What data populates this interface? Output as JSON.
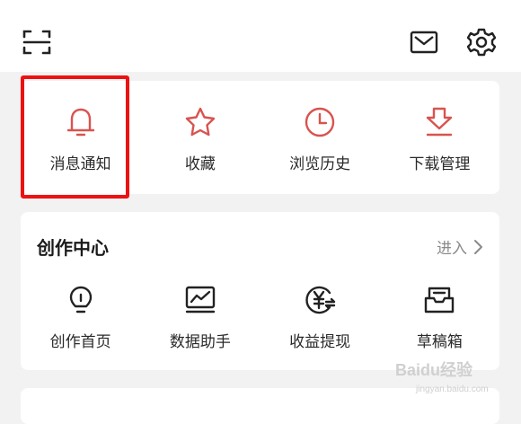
{
  "header": {
    "icons": [
      "scan-icon",
      "mail-icon",
      "gear-icon"
    ]
  },
  "quick_actions": [
    {
      "label": "消息通知",
      "icon": "bell-icon"
    },
    {
      "label": "收藏",
      "icon": "star-icon"
    },
    {
      "label": "浏览历史",
      "icon": "clock-icon"
    },
    {
      "label": "下载管理",
      "icon": "download-icon"
    }
  ],
  "creation_center": {
    "title": "创作中心",
    "enter_label": "进入",
    "items": [
      {
        "label": "创作首页",
        "icon": "lightbulb-icon"
      },
      {
        "label": "数据助手",
        "icon": "chart-icon"
      },
      {
        "label": "收益提现",
        "icon": "yuan-icon"
      },
      {
        "label": "草稿箱",
        "icon": "draft-box-icon"
      }
    ]
  },
  "highlight_color": "#ee1111",
  "accent_color": "#d9534f",
  "watermark": {
    "brand": "Baidu经验",
    "url": "jingyan.baidu.com"
  }
}
